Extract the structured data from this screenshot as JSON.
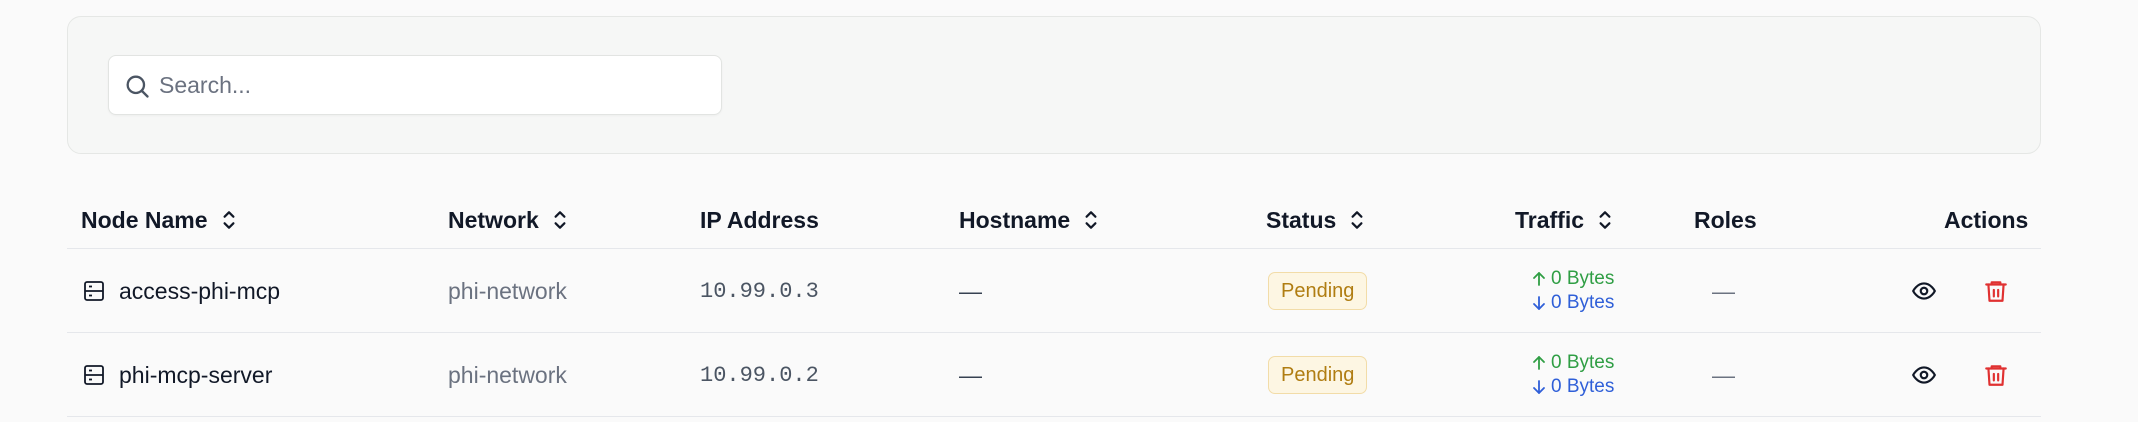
{
  "search": {
    "placeholder": "Search..."
  },
  "table": {
    "headers": {
      "node_name": "Node Name",
      "network": "Network",
      "ip_address": "IP Address",
      "hostname": "Hostname",
      "status": "Status",
      "traffic": "Traffic",
      "roles": "Roles",
      "actions": "Actions"
    },
    "rows": [
      {
        "node_name": "access-phi-mcp",
        "network": "phi-network",
        "ip": "10.99.0.3",
        "hostname": "—",
        "status": "Pending",
        "traffic_up": "0 Bytes",
        "traffic_down": "0 Bytes",
        "roles": "—"
      },
      {
        "node_name": "phi-mcp-server",
        "network": "phi-network",
        "ip": "10.99.0.2",
        "hostname": "—",
        "status": "Pending",
        "traffic_up": "0 Bytes",
        "traffic_down": "0 Bytes",
        "roles": "—"
      }
    ]
  },
  "icons": {
    "search": "search-icon",
    "sort": "sort-icon",
    "node": "server-icon",
    "view": "eye-icon",
    "delete": "trash-icon",
    "up": "arrow-up-icon",
    "down": "arrow-down-icon"
  },
  "colors": {
    "pending_text": "#b07d12",
    "pending_bg": "#fdf6e3",
    "traffic_up": "#2f9e44",
    "traffic_down": "#2f5fd8",
    "delete": "#e03131"
  }
}
